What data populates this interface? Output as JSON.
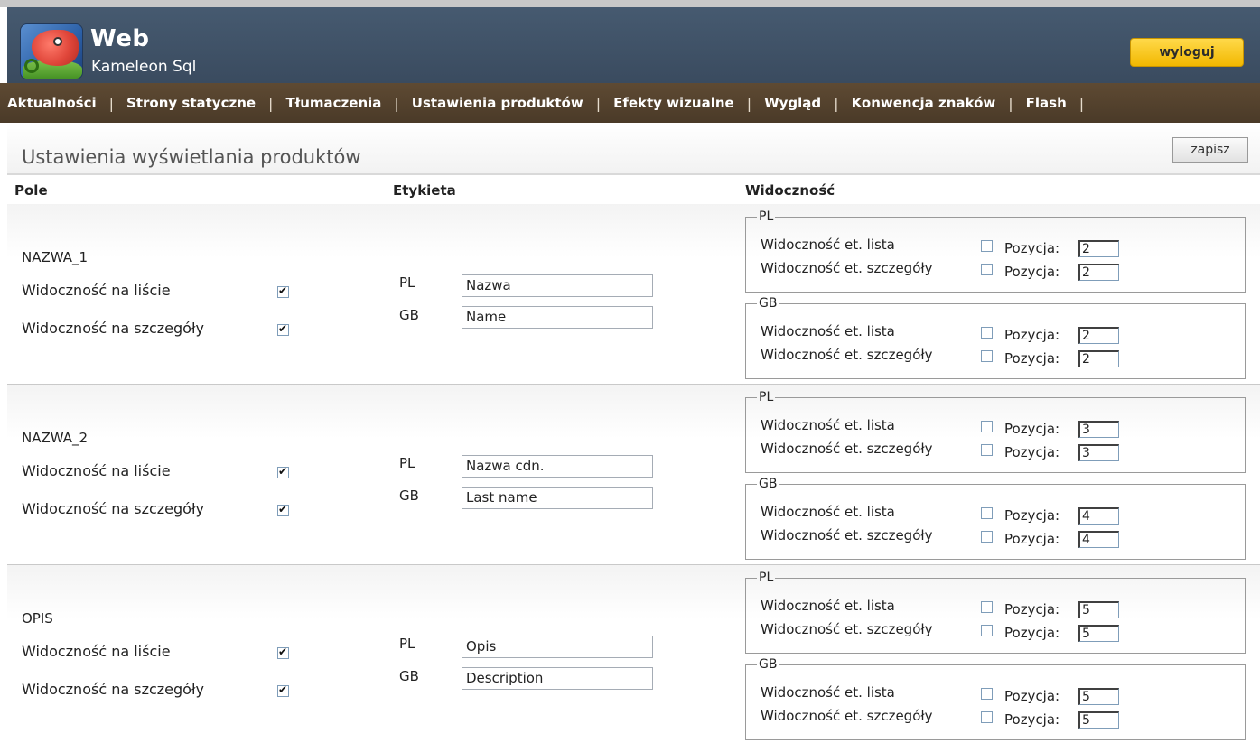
{
  "app": {
    "title": "Web",
    "subtitle": "Kameleon Sql",
    "logout_label": "wyloguj"
  },
  "nav": {
    "items": [
      "Aktualności",
      "Strony statyczne",
      "Tłumaczenia",
      "Ustawienia produktów",
      "Efekty wizualne",
      "Wygląd",
      "Konwencja znaków",
      "Flash"
    ],
    "separator": "|"
  },
  "page": {
    "title": "Ustawienia wyświetlania produktów",
    "save_label": "zapisz"
  },
  "columns": {
    "pole": "Pole",
    "etykieta": "Etykieta",
    "widocznosc": "Widoczność"
  },
  "labels": {
    "list_visibility": "Widoczność na liście",
    "detail_visibility": "Widoczność na szczegóły",
    "et_list": "Widoczność et. lista",
    "et_detail": "Widoczność et. szczegóły",
    "position": "Pozycja:"
  },
  "fields": [
    {
      "name": "NAZWA_1",
      "list_checked": true,
      "detail_checked": true,
      "labels": {
        "pl_lang": "PL",
        "pl": "Nazwa",
        "gb_lang": "GB",
        "gb": "Name"
      },
      "visibility": {
        "pl": {
          "legend": "PL",
          "list_pos": "2",
          "detail_pos": "2",
          "list_checked": false,
          "detail_checked": false
        },
        "gb": {
          "legend": "GB",
          "list_pos": "2",
          "detail_pos": "2",
          "list_checked": false,
          "detail_checked": false
        }
      }
    },
    {
      "name": "NAZWA_2",
      "list_checked": true,
      "detail_checked": true,
      "labels": {
        "pl_lang": "PL",
        "pl": "Nazwa cdn.",
        "gb_lang": "GB",
        "gb": "Last name"
      },
      "visibility": {
        "pl": {
          "legend": "PL",
          "list_pos": "3",
          "detail_pos": "3",
          "list_checked": false,
          "detail_checked": false
        },
        "gb": {
          "legend": "GB",
          "list_pos": "4",
          "detail_pos": "4",
          "list_checked": false,
          "detail_checked": false
        }
      }
    },
    {
      "name": "OPIS",
      "list_checked": true,
      "detail_checked": true,
      "labels": {
        "pl_lang": "PL",
        "pl": "Opis",
        "gb_lang": "GB",
        "gb": "Description"
      },
      "visibility": {
        "pl": {
          "legend": "PL",
          "list_pos": "5",
          "detail_pos": "5",
          "list_checked": false,
          "detail_checked": false
        },
        "gb": {
          "legend": "GB",
          "list_pos": "5",
          "detail_pos": "5",
          "list_checked": false,
          "detail_checked": false
        }
      }
    }
  ]
}
